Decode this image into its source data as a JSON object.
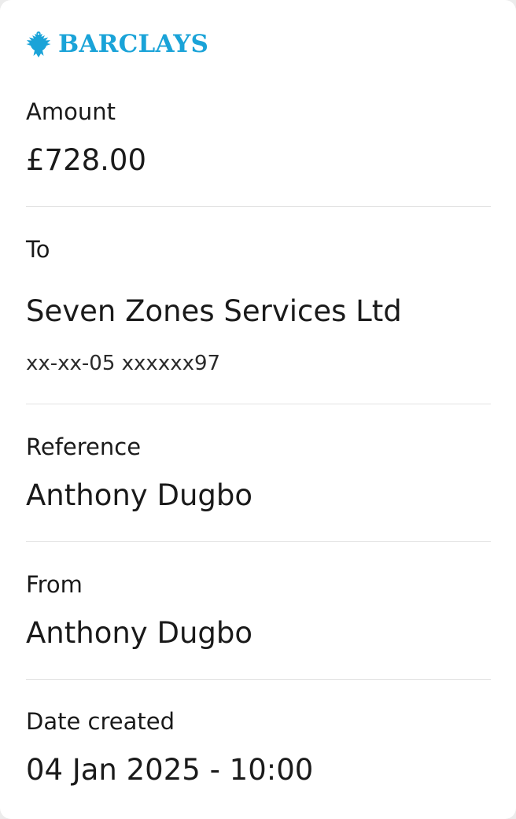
{
  "brand": {
    "name": "BARCLAYS",
    "color": "#1aa3d8",
    "icon": "eagle-icon"
  },
  "amount": {
    "label": "Amount",
    "value": "£728.00"
  },
  "to": {
    "label": "To",
    "payee": "Seven Zones Services Ltd",
    "account": "xx-xx-05 xxxxxx97"
  },
  "reference": {
    "label": "Reference",
    "value": "Anthony Dugbo"
  },
  "from": {
    "label": "From",
    "value": "Anthony Dugbo"
  },
  "date_created": {
    "label": "Date created",
    "value": "04 Jan 2025 - 10:00"
  }
}
